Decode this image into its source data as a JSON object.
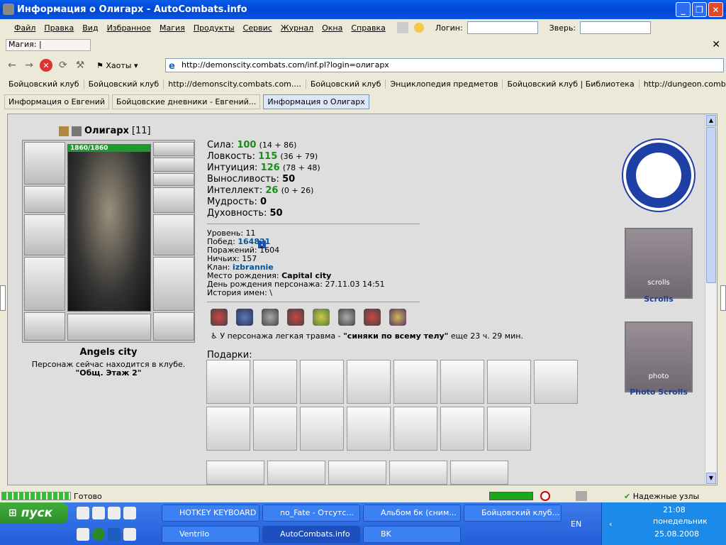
{
  "window": {
    "title": "Информация о Олигарх - AutoCombats.info"
  },
  "menu": [
    "Файл",
    "Правка",
    "Вид",
    "Избранное",
    "Магия",
    "Продукты",
    "Сервис",
    "Журнал",
    "Окна",
    "Справка"
  ],
  "login_label": "Логин:",
  "beast_label": "Зверь:",
  "magic_label": "Магия:",
  "nav": {
    "chaos_label": "Хаоты",
    "url": "http://demonscity.combats.com/inf.pl?login=олигарх"
  },
  "links": [
    "Бойцовский клуб",
    "Бойцовский клуб",
    "http://demonscity.combats.com....",
    "Бойцовский клуб",
    "Энциклопедия предметов",
    "Бойцовский клуб | Библиотека",
    "http://dungeon.combats.com/lo..."
  ],
  "tabs": [
    "Информация о Евгений",
    "Бойцовские дневники - Евгений...",
    "Информация о Олигарх"
  ],
  "character": {
    "name": "Олигарх",
    "level_display": "[11]",
    "hp": "1860/1860",
    "city": "Angels city",
    "location_line": "Персонаж сейчас находится в клубе.",
    "location_room": "\"Общ. Этаж 2\""
  },
  "stats": [
    {
      "label": "Сила:",
      "value": "100",
      "detail": "(14 + 86)",
      "green": true
    },
    {
      "label": "Ловкость:",
      "value": "115",
      "detail": "(36 + 79)",
      "green": true
    },
    {
      "label": "Интуиция:",
      "value": "126",
      "detail": "(78 + 48)",
      "green": true
    },
    {
      "label": "Выносливость:",
      "value": "50",
      "detail": "",
      "green": false
    },
    {
      "label": "Интеллект:",
      "value": "26",
      "detail": "(0 + 26)",
      "green": true
    },
    {
      "label": "Мудрость:",
      "value": "0",
      "detail": "",
      "green": false
    },
    {
      "label": "Духовность:",
      "value": "50",
      "detail": "",
      "green": false
    }
  ],
  "info": {
    "level": "Уровень: 11",
    "wins_label": "Побед: ",
    "wins": "164821",
    "losses": "Поражений: 1604",
    "draws": "Ничьих: 157",
    "clan_label": "Клан: ",
    "clan": "izbrannie",
    "birthplace_label": "Место рождения: ",
    "birthplace": "Capital city",
    "birthday": "День рождения персонажа: 27.11.03 14:51",
    "name_history": "История имен: \\"
  },
  "trauma": {
    "prefix": "У персонажа легкая травма - ",
    "name": "\"синяки по всему телу\"",
    "suffix": " еще 23 ч. 29 мин."
  },
  "gifts_title": "Подарки:",
  "right_panel": {
    "scrolls": "Scrolls",
    "photo_scrolls": "Photo Scrolls",
    "banner1_text": "scrolls",
    "banner2_text": "photo"
  },
  "status": {
    "text": "Готово",
    "secure": "Надежные узлы"
  },
  "taskbar": {
    "start": "пуск",
    "tasks_top": [
      "HOTKEY KEYBOARD",
      "no_Fate - Отсутс...",
      "Альбом бк (сним...",
      "Бойцовский клуб..."
    ],
    "tasks_bottom": [
      "Ventrilo",
      "AutoCombats.info",
      "BK"
    ],
    "lang": "EN",
    "time": "21:08",
    "day": "понедельник",
    "date": "25.08.2008"
  }
}
